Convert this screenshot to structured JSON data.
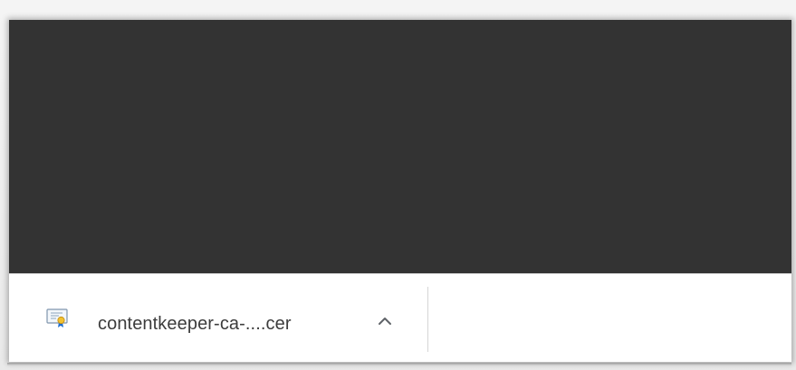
{
  "download_shelf": {
    "items": [
      {
        "file_name": "contentkeeper-ca-....cer",
        "icon": "certificate-file-icon",
        "menu_icon": "chevron-up-icon"
      }
    ]
  },
  "colors": {
    "content_background": "#333333",
    "shelf_background": "#ffffff",
    "divider": "#d6d6d6",
    "text": "#3c3c3c"
  }
}
